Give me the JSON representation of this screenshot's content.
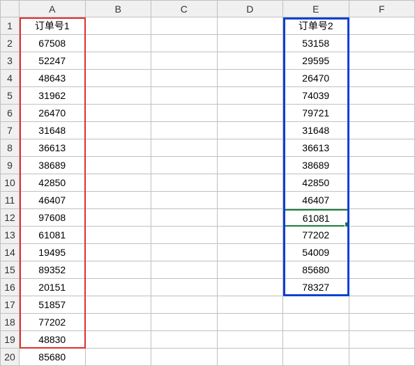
{
  "columns": [
    "A",
    "B",
    "C",
    "D",
    "E",
    "F"
  ],
  "rows": 20,
  "active_cell": {
    "col": 5,
    "row": 12
  },
  "highlight_boxes": {
    "red": {
      "col": "A",
      "from_row": 1,
      "to_row": 20
    },
    "blue": {
      "col": "E",
      "from_row": 1,
      "to_row": 16
    }
  },
  "colA_header": "订单号1",
  "colE_header": "订单号2",
  "colA_data": [
    "67508",
    "52247",
    "48643",
    "31962",
    "26470",
    "31648",
    "36613",
    "38689",
    "42850",
    "46407",
    "97608",
    "61081",
    "19495",
    "89352",
    "20151",
    "51857",
    "77202",
    "48830",
    "85680"
  ],
  "colE_data": [
    "53158",
    "29595",
    "26470",
    "74039",
    "79721",
    "31648",
    "36613",
    "38689",
    "42850",
    "46407",
    "61081",
    "77202",
    "54009",
    "85680",
    "78327"
  ],
  "chart_data": {
    "type": "table",
    "title": "",
    "columns": [
      "订单号1",
      "订单号2"
    ],
    "series": [
      {
        "name": "订单号1",
        "values": [
          67508,
          52247,
          48643,
          31962,
          26470,
          31648,
          36613,
          38689,
          42850,
          46407,
          97608,
          61081,
          19495,
          89352,
          20151,
          51857,
          77202,
          48830,
          85680
        ]
      },
      {
        "name": "订单号2",
        "values": [
          53158,
          29595,
          26470,
          74039,
          79721,
          31648,
          36613,
          38689,
          42850,
          46407,
          61081,
          77202,
          54009,
          85680,
          78327
        ]
      }
    ]
  }
}
